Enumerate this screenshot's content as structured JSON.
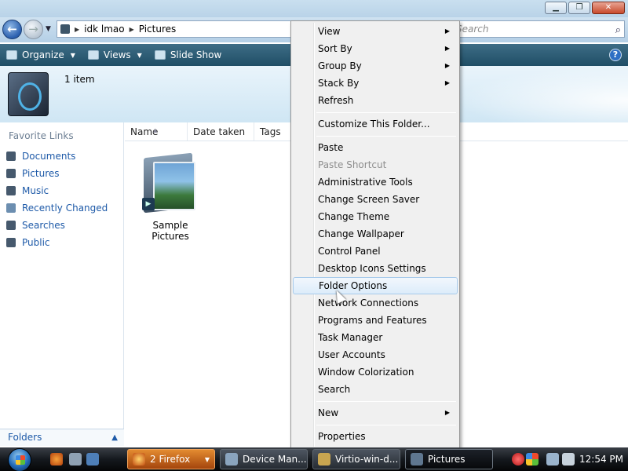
{
  "window": {
    "minimize": "▁",
    "maximize": "❐",
    "close": "✕"
  },
  "nav": {
    "back_glyph": "←",
    "forward_glyph": "→",
    "breadcrumb": [
      "idk lmao",
      "Pictures"
    ],
    "search_placeholder": "Search",
    "search_icon": "search-icon"
  },
  "toolbar": {
    "organize": "Organize",
    "views": "Views",
    "slideshow": "Slide Show",
    "help": "?"
  },
  "details": {
    "item_count": "1 item"
  },
  "sidebar": {
    "title": "Favorite Links",
    "items": [
      {
        "label": "Documents"
      },
      {
        "label": "Pictures"
      },
      {
        "label": "Music"
      },
      {
        "label": "Recently Changed"
      },
      {
        "label": "Searches"
      },
      {
        "label": "Public"
      }
    ],
    "folders_label": "Folders"
  },
  "content": {
    "columns": [
      "Name",
      "Date taken",
      "Tags"
    ],
    "files": [
      {
        "label": "Sample Pictures"
      }
    ]
  },
  "context_menu": {
    "items": [
      {
        "label": "View",
        "submenu": true
      },
      {
        "label": "Sort By",
        "submenu": true
      },
      {
        "label": "Group By",
        "submenu": true
      },
      {
        "label": "Stack By",
        "submenu": true
      },
      {
        "label": "Refresh"
      },
      {
        "label": "Customize This Folder..."
      },
      {
        "label": "Paste"
      },
      {
        "label": "Paste Shortcut",
        "disabled": true
      },
      {
        "label": "Administrative Tools"
      },
      {
        "label": "Change Screen Saver"
      },
      {
        "label": "Change Theme"
      },
      {
        "label": "Change Wallpaper"
      },
      {
        "label": "Control Panel"
      },
      {
        "label": "Desktop Icons Settings"
      },
      {
        "label": "Folder Options",
        "highlighted": true
      },
      {
        "label": "Network Connections"
      },
      {
        "label": "Programs and Features"
      },
      {
        "label": "Task Manager"
      },
      {
        "label": "User Accounts"
      },
      {
        "label": "Window Colorization"
      },
      {
        "label": "Search"
      },
      {
        "label": "New",
        "submenu": true
      },
      {
        "label": "Properties"
      }
    ]
  },
  "taskbar": {
    "tasks": [
      {
        "label": "2 Firefox"
      },
      {
        "label": "Device Man..."
      },
      {
        "label": "Virtio-win-d..."
      },
      {
        "label": "Pictures"
      }
    ],
    "clock": "12:54 PM"
  },
  "colors": {
    "toolbar": "#1f4e66",
    "link": "#1e5aa8",
    "menu_bg": "#f0f0f0",
    "highlight_border": "#a8cbeb"
  }
}
